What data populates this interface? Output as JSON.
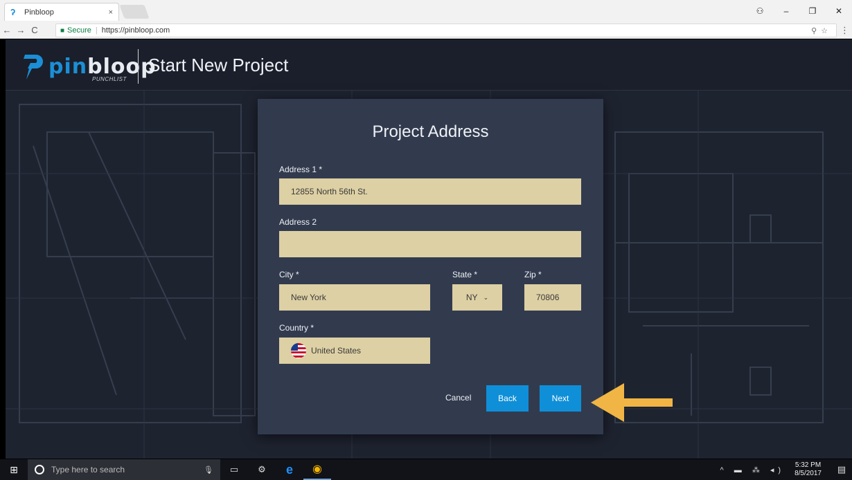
{
  "browser": {
    "tab_title": "Pinbloop",
    "tab_close": "×",
    "secure_label": "Secure",
    "url": "https://pinbloop.com",
    "nav": {
      "back": "←",
      "forward": "→",
      "reload": "C"
    },
    "window_controls": {
      "account": "⚇",
      "minimize": "–",
      "maximize": "❐",
      "close": "✕"
    },
    "omnibox_icons": "⚲☆",
    "menu": "⋮"
  },
  "header": {
    "logo_pin": "pin",
    "logo_bloop": "bloop",
    "logo_sub": "PUNCHLIST",
    "title": "Start New Project"
  },
  "form": {
    "title": "Project Address",
    "address1": {
      "label": "Address 1 *",
      "value": "12855 North 56th St."
    },
    "address2": {
      "label": "Address 2",
      "value": ""
    },
    "city": {
      "label": "City *",
      "value": "New York"
    },
    "state": {
      "label": "State *",
      "value": "NY",
      "chevron": "⌄"
    },
    "zip": {
      "label": "Zip *",
      "value": "70806"
    },
    "country": {
      "label": "Country *",
      "value": "United States",
      "flag_icon": "us-flag-icon"
    }
  },
  "actions": {
    "cancel": "Cancel",
    "back": "Back",
    "next": "Next"
  },
  "colors": {
    "accent": "#0f8fd8",
    "input_bg": "#ddd0a4",
    "modal_bg": "#323b4e",
    "arrow": "#f0b545"
  },
  "taskbar": {
    "start_icon": "⊞",
    "search_placeholder": "Type here to search",
    "mic_icon": "🎙",
    "task_view_icon": "▭",
    "app_icons": [
      "⚙",
      "e",
      "◉"
    ],
    "tray_icons": "^ ▬ ⁂ ◂)",
    "time": "5:32 PM",
    "date": "8/5/2017",
    "notification_icon": "▤"
  }
}
